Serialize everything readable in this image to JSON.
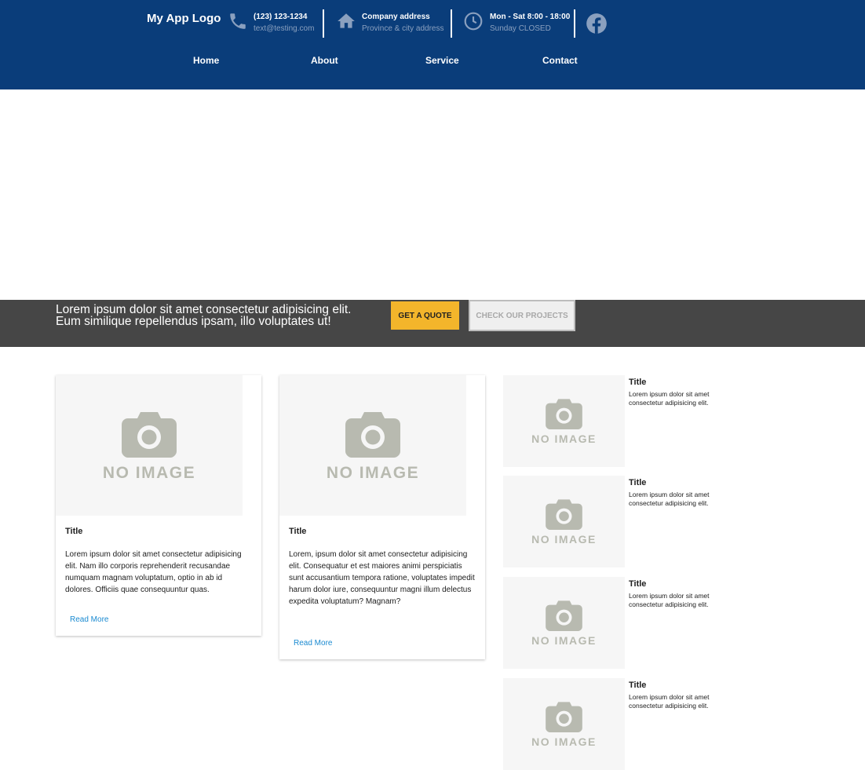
{
  "header": {
    "logo": "My App Logo",
    "phone": {
      "line1": "(123) 123-1234",
      "line2": "text@testing.com",
      "icon": "phone-icon"
    },
    "address": {
      "line1": "Company address",
      "line2": "Province & city address",
      "icon": "home-icon"
    },
    "hours": {
      "line1": "Mon - Sat 8:00 - 18:00",
      "line2": "Sunday CLOSED",
      "icon": "clock-icon"
    },
    "social_icon": "facebook-icon",
    "colors": {
      "background": "#0a3d7a",
      "secondary_text": "#8aa0bf"
    }
  },
  "nav": {
    "items": [
      {
        "label": "Home"
      },
      {
        "label": "About"
      },
      {
        "label": "Service"
      },
      {
        "label": "Contact"
      }
    ]
  },
  "banner": {
    "text": "Lorem ipsum dolor sit amet consectetur adipisicing elit. Eum similique repellendus ipsam, illo voluptates ut!",
    "primary_button": "GET A QUOTE",
    "secondary_button": "CHECK OUR PROJECTS",
    "colors": {
      "background": "#464646",
      "primary": "#f3b52b"
    }
  },
  "cards": [
    {
      "image_text": "NO IMAGE",
      "title": "Title",
      "body": "Lorem ipsum dolor sit amet consectetur adipisicing elit. Nam illo corporis reprehenderit recusandae numquam magnam voluptatum, optio in ab id dolores. Officiis quae consequuntur quas.",
      "link": "Read More"
    },
    {
      "image_text": "NO IMAGE",
      "title": "Title",
      "body": "Lorem, ipsum dolor sit amet consectetur adipisicing elit. Consequatur et est maiores animi perspiciatis sunt accusantium tempora ratione, voluptates impedit harum dolor iure, consequuntur magni illum delectus expedita voluptatum? Magnam?",
      "link": "Read More"
    }
  ],
  "side_items": [
    {
      "image_text": "NO IMAGE",
      "title": "Title",
      "body": "Lorem ipsum dolor sit amet consectetur adipisicing elit."
    },
    {
      "image_text": "NO IMAGE",
      "title": "Title",
      "body": "Lorem ipsum dolor sit amet consectetur adipisicing elit."
    },
    {
      "image_text": "NO IMAGE",
      "title": "Title",
      "body": "Lorem ipsum dolor sit amet consectetur adipisicing elit."
    },
    {
      "image_text": "NO IMAGE",
      "title": "Title",
      "body": "Lorem ipsum dolor sit amet consectetur adipisicing elit."
    }
  ],
  "link_color": "#1a8ad1"
}
